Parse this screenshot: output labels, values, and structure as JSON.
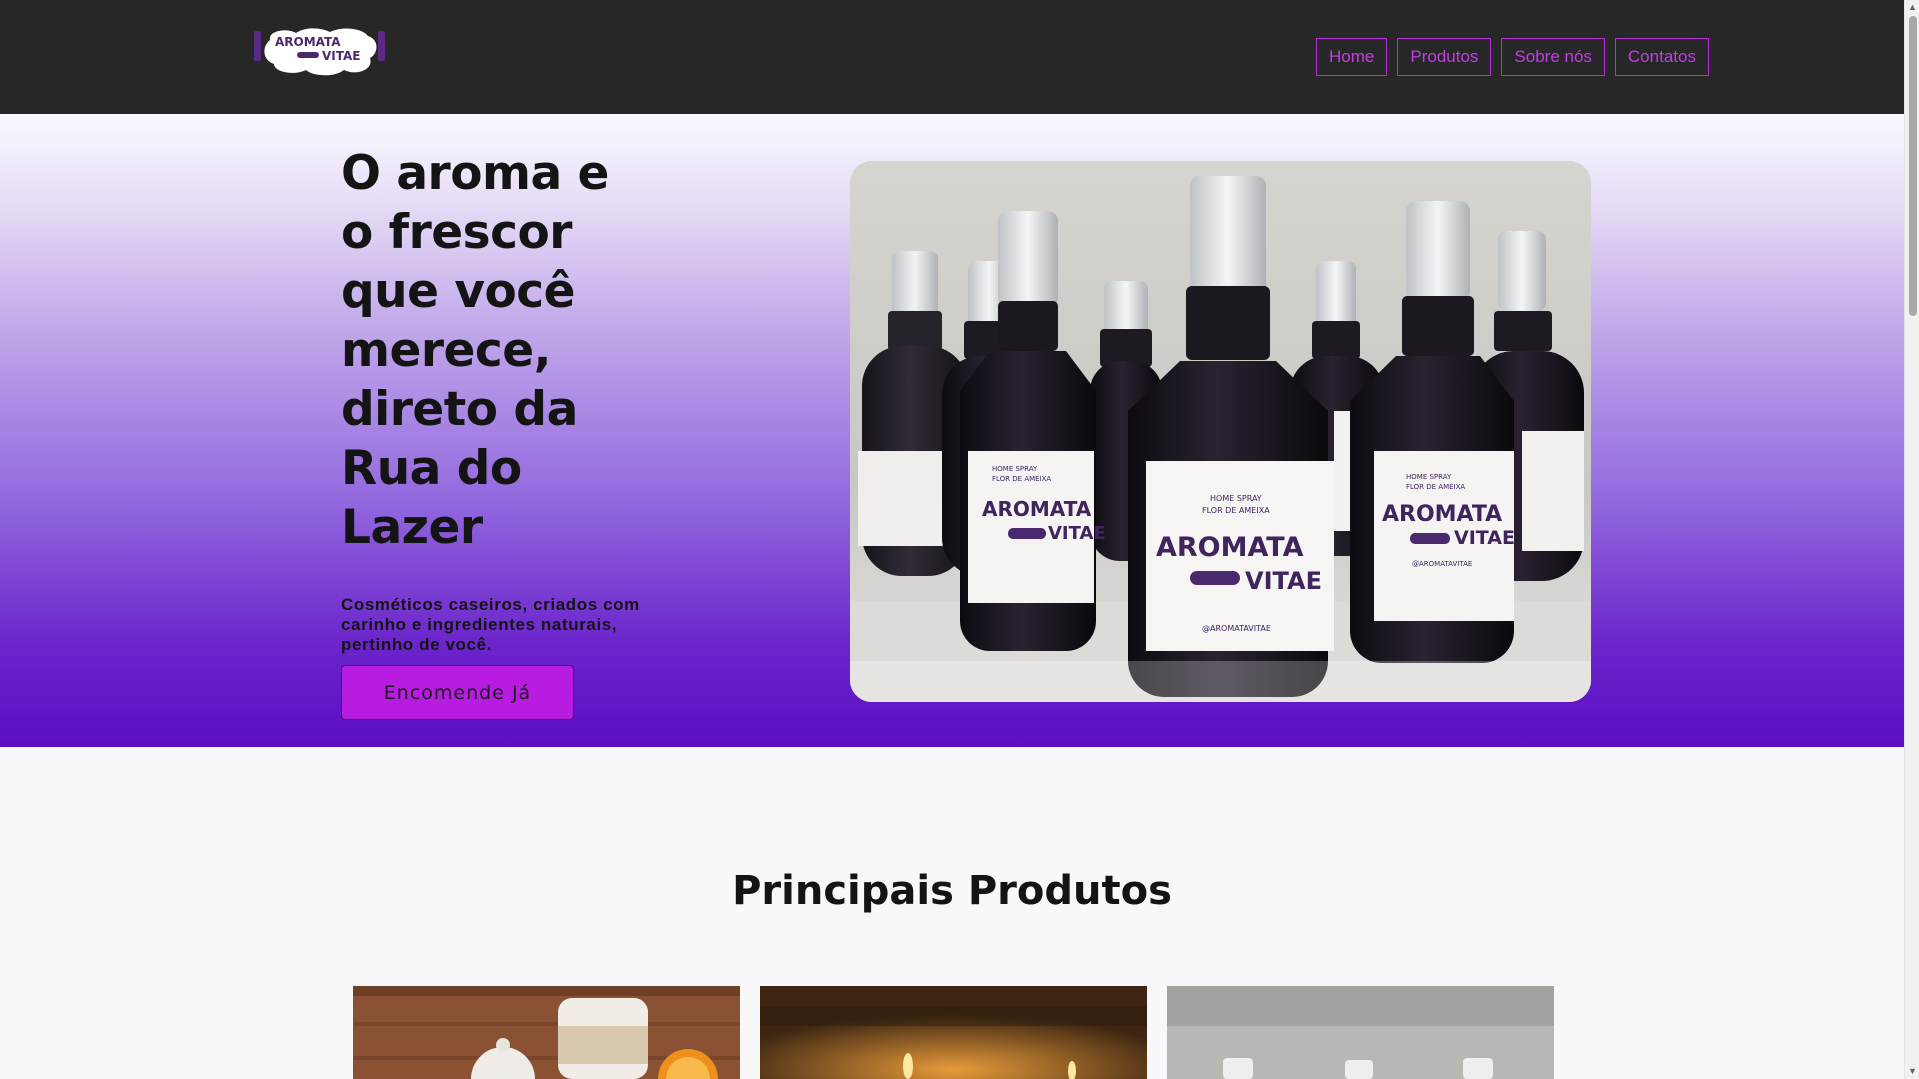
{
  "logo": {
    "line1": "AROMATA",
    "line2": "VITAE"
  },
  "nav": [
    {
      "label": "Home"
    },
    {
      "label": "Produtos"
    },
    {
      "label": "Sobre nós"
    },
    {
      "label": "Contatos"
    }
  ],
  "hero": {
    "title": "O aroma e o frescor que você merece, direto da Rua do Lazer",
    "subtitle": "Cosméticos caseiros, criados com carinho e ingredientes naturais, pertinho de você.",
    "cta_label": "Encomende Já",
    "bottle_label": {
      "brand1": "AROMATA",
      "brand2": "VITAE",
      "small1": "HOME SPRAY",
      "small2": "FLOR DE AMEIXA",
      "handle": "@AROMATAVITAE"
    }
  },
  "products": {
    "title": "Principais Produtos"
  },
  "colors": {
    "header_bg": "#272727",
    "nav_accent": "#c23ee6",
    "cta_bg": "#b81ce0",
    "hero_gradient_end": "#5a0fc2",
    "brand_purple": "#4a2a6e"
  }
}
